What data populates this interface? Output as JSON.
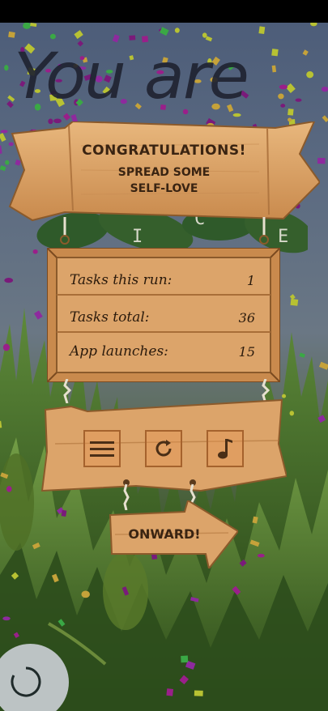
{
  "headline": "You are",
  "banner": {
    "title": "CONGRATULATIONS!",
    "line1": "SPREAD SOME",
    "line2": "SELF-LOVE"
  },
  "leaf_letters": [
    "I",
    "C",
    "E"
  ],
  "stats": [
    {
      "label": "Tasks this run:",
      "value": "1"
    },
    {
      "label": "Tasks total:",
      "value": "36"
    },
    {
      "label": "App launches:",
      "value": "15"
    }
  ],
  "buttons": {
    "menu_icon": "hamburger-menu-icon",
    "restart_icon": "restart-icon",
    "music_icon": "music-note-icon"
  },
  "onward_label": "ONWARD!",
  "colors": {
    "wood": "#d9a066",
    "wood_dark": "#a5622d",
    "text_dark": "#3a2412",
    "sky_top": "#4d5d79",
    "grass": "#2e4a1e"
  }
}
